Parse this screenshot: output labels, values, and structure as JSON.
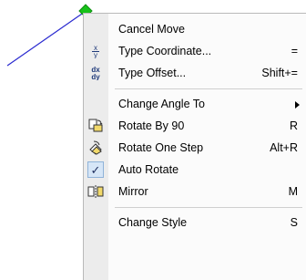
{
  "menu": {
    "items": [
      {
        "label": "Cancel Move",
        "shortcut": "",
        "icon": "none"
      },
      {
        "label": "Type Coordinate...",
        "shortcut": "=",
        "icon": "xy-coordinate-icon"
      },
      {
        "label": "Type Offset...",
        "shortcut": "Shift+=",
        "icon": "dx-dy-offset-icon"
      },
      {
        "label": "Change Angle To",
        "shortcut": "",
        "icon": "none",
        "submenu": true
      },
      {
        "label": "Rotate By 90",
        "shortcut": "R",
        "icon": "rotate-90-icon"
      },
      {
        "label": "Rotate One Step",
        "shortcut": "Alt+R",
        "icon": "rotate-step-icon"
      },
      {
        "label": "Auto Rotate",
        "shortcut": "",
        "icon": "checkmark-icon",
        "checked": true
      },
      {
        "label": "Mirror",
        "shortcut": "M",
        "icon": "mirror-icon"
      },
      {
        "label": "Change Style",
        "shortcut": "S",
        "icon": "none"
      }
    ]
  },
  "colors": {
    "line": "#2a2ad0",
    "handle": "#17c21a",
    "menu_bg": "#fbfbfb",
    "gutter": "#ececec",
    "checked_bg": "#d6e6f7"
  }
}
